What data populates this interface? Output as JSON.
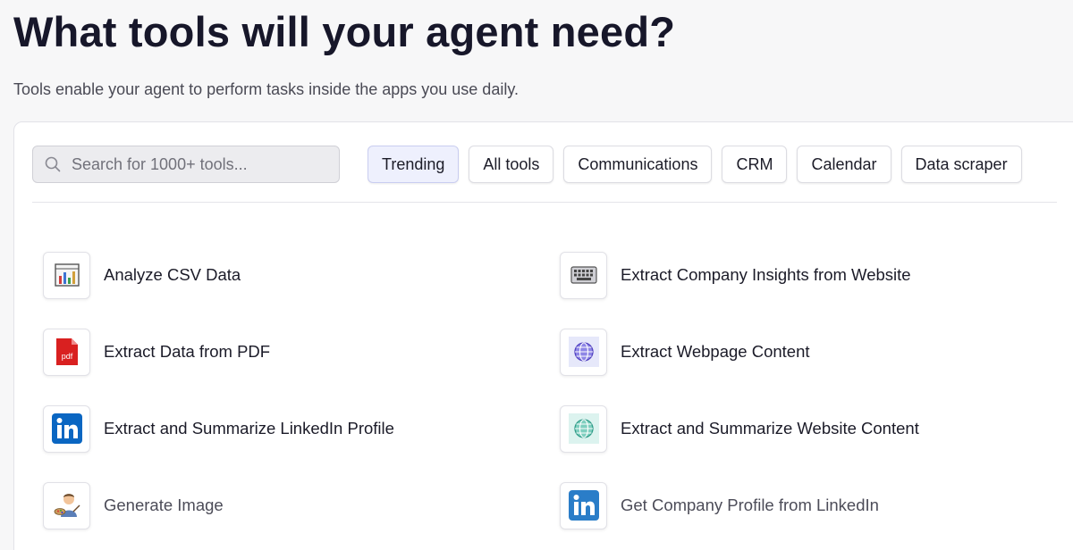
{
  "header": {
    "title": "What tools will your agent need?",
    "subtitle": "Tools enable your agent to perform tasks inside the apps you use daily."
  },
  "search": {
    "placeholder": "Search for 1000+ tools...",
    "icon": "search-icon"
  },
  "filters": [
    {
      "label": "Trending",
      "active": true
    },
    {
      "label": "All tools",
      "active": false
    },
    {
      "label": "Communications",
      "active": false
    },
    {
      "label": "CRM",
      "active": false
    },
    {
      "label": "Calendar",
      "active": false
    },
    {
      "label": "Data scraper",
      "active": false
    }
  ],
  "tools": [
    {
      "label": "Analyze CSV Data",
      "icon": "bar-chart-icon"
    },
    {
      "label": "Extract Company Insights from Website",
      "icon": "keyboard-icon"
    },
    {
      "label": "Extract Data from PDF",
      "icon": "pdf-icon"
    },
    {
      "label": "Extract Webpage Content",
      "icon": "globe-icon"
    },
    {
      "label": "Extract and Summarize LinkedIn Profile",
      "icon": "linkedin-icon"
    },
    {
      "label": "Extract and Summarize Website Content",
      "icon": "globe-icon"
    },
    {
      "label": "Generate Image",
      "icon": "artist-icon"
    },
    {
      "label": "Get Company Profile from LinkedIn",
      "icon": "linkedin-icon"
    }
  ],
  "colors": {
    "active_chip_bg": "#eef0fd",
    "linkedin_blue": "#0a66c2",
    "pdf_red": "#d92020"
  }
}
